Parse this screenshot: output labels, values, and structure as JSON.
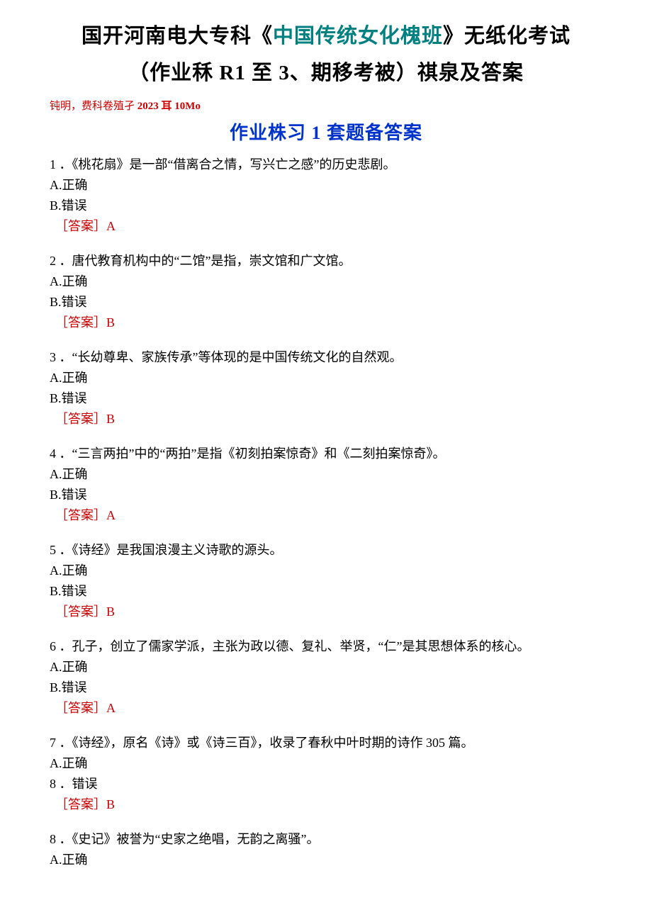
{
  "title": {
    "line1_pre": "国开河南电大专科《",
    "line1_teal": "中国传统女化槐班",
    "line1_post": "》无纸化考试",
    "line2_pre": "（作业秝 ",
    "line2_r1": "R1",
    "line2_mid": " 至 ",
    "line2_three": "3",
    "line2_post": "、期移考被）祺泉及答案"
  },
  "note": {
    "pre": "钝明，费科卷殖孑 ",
    "year": "2023",
    "mid": " 耳 ",
    "suffix": "10Mo"
  },
  "section_heading": {
    "pre": "作业株习 ",
    "num": "1",
    "post": " 套题备答案"
  },
  "questions": [
    {
      "num": "1",
      "text": " ．《桃花扇》是一部“借离合之情，写兴亡之感”的历史悲剧。",
      "optA": "A.正确",
      "optB": "B.错误",
      "answer": "［答案］A"
    },
    {
      "num": "2",
      "text": " ．唐代教育机构中的“二馆”是指，崇文馆和广文馆。",
      "optA": "A.正确",
      "optB": "B.错误",
      "answer": "［答案］B"
    },
    {
      "num": "3",
      "text": " ．“长幼尊卑、家族传承”等体现的是中国传统文化的自然观。",
      "optA": "A.正确",
      "optB": "B.错误",
      "answer": "［答案］B"
    },
    {
      "num": "4",
      "text": " ．“三言两拍”中的“两拍”是指《初刻拍案惊奇》和《二刻拍案惊奇》。",
      "optA": "A.正确",
      "optB": "B.错误",
      "answer": "［答案］A"
    },
    {
      "num": "5",
      "text": " ．《诗经》是我国浪漫主义诗歌的源头。",
      "optA": "A.正确",
      "optB": "B.错误",
      "answer": "［答案］B"
    },
    {
      "num": "6",
      "text": " ．孔子，创立了儒家学派，主张为政以德、复礼、举贤，“仁”是其思想体系的核心。",
      "optA": "A.正确",
      "optB": "B.错误",
      "answer": "［答案］A"
    },
    {
      "num": "7",
      "text": " ．《诗经》，原名《诗》或《诗三百》，收录了春秋中叶时期的诗作 305 篇。",
      "optA": "A.正确",
      "optB_num": "8",
      "optB_text": " ．错误",
      "answer": "［答案］B"
    },
    {
      "num": "8",
      "text": " ．《史记》被誉为“史家之绝唱，无韵之离骚”。",
      "optA": "A.正确"
    }
  ]
}
